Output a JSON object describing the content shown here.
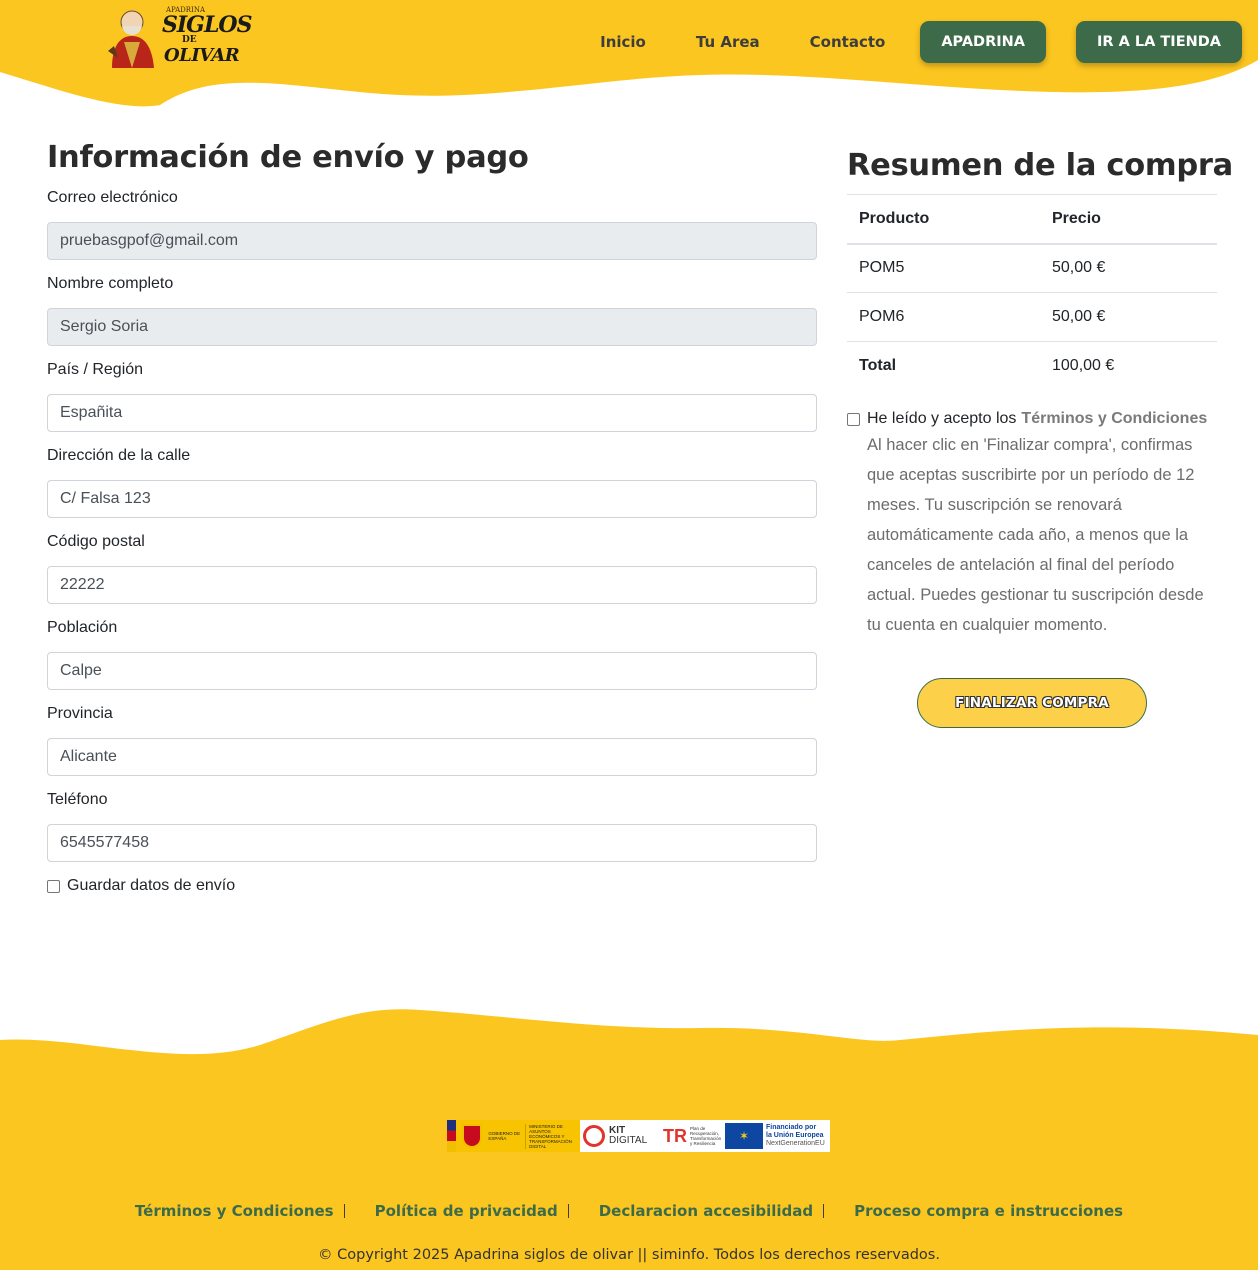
{
  "header": {
    "logo_alt": "Apadrina Siglos de Olivar",
    "logo_text_top": "APADRINA",
    "logo_text_main": "SIGLOS",
    "logo_text_de": "DE",
    "logo_text_bottom": "OLIVAR",
    "nav": [
      {
        "label": "Inicio"
      },
      {
        "label": "Tu Area"
      },
      {
        "label": "Contacto"
      }
    ],
    "apadrina_label": "APADRINA",
    "shop_label": "IR A LA TIENDA",
    "brand_yellow": "#fcc620",
    "brand_green": "#3d6b4a"
  },
  "form": {
    "title": "Información de envío y pago",
    "fields": [
      {
        "label": "Correo electrónico",
        "value": "pruebasgpof@gmail.com",
        "readonly": true
      },
      {
        "label": "Nombre completo",
        "value": "Sergio Soria",
        "readonly": true
      },
      {
        "label": "País / Región",
        "value": "Españita",
        "readonly": false
      },
      {
        "label": "Dirección de la calle",
        "value": "C/ Falsa 123",
        "readonly": false
      },
      {
        "label": "Código postal",
        "value": "22222",
        "readonly": false
      },
      {
        "label": "Población",
        "value": "Calpe",
        "readonly": false
      },
      {
        "label": "Provincia",
        "value": "Alicante",
        "readonly": false
      },
      {
        "label": "Teléfono",
        "value": "6545577458",
        "readonly": false
      }
    ],
    "save_label": "Guardar datos de envío",
    "save_checked": false
  },
  "summary": {
    "title": "Resumen de la compra",
    "col_product": "Producto",
    "col_price": "Precio",
    "rows": [
      {
        "product": "POM5",
        "price": "50,00 €"
      },
      {
        "product": "POM6",
        "price": "50,00 €"
      }
    ],
    "total_label": "Total",
    "total_value": "100,00 €",
    "terms_prefix": "He leído y acepto los",
    "terms_link": "Términos y Condiciones",
    "terms_checked": false,
    "terms_desc": "Al hacer clic en 'Finalizar compra', confirmas que aceptas suscribirte por un período de 12 meses. Tu suscripción se renovará automáticamente cada año, a menos que la canceles de antelación al final del período actual. Puedes gestionar tu suscripción desde tu cuenta en cualquier momento.",
    "finalize_label": "FINALIZAR COMPRA"
  },
  "footer": {
    "funding": {
      "gob_text": "GOBIERNO DE ESPAÑA",
      "ministry_text": "MINISTERIO DE ASUNTOS ECONÓMICOS Y TRANSFORMACIÓN DIGITAL",
      "kit_text_1": "KIT",
      "kit_text_2": "DIGITAL",
      "prtr_text": "Plan de Recuperación, Transformación y Resiliencia",
      "eu_text_1": "Financiado por",
      "eu_text_2": "la Unión Europea",
      "eu_text_3": "NextGenerationEU"
    },
    "links": [
      {
        "label": "Términos y Condiciones"
      },
      {
        "label": "Política de privacidad"
      },
      {
        "label": "Declaracion accesibilidad"
      },
      {
        "label": "Proceso compra e instrucciones"
      }
    ],
    "copyright": "© Copyright 2025 Apadrina siglos de olivar || siminfo. Todos los derechos reservados."
  }
}
